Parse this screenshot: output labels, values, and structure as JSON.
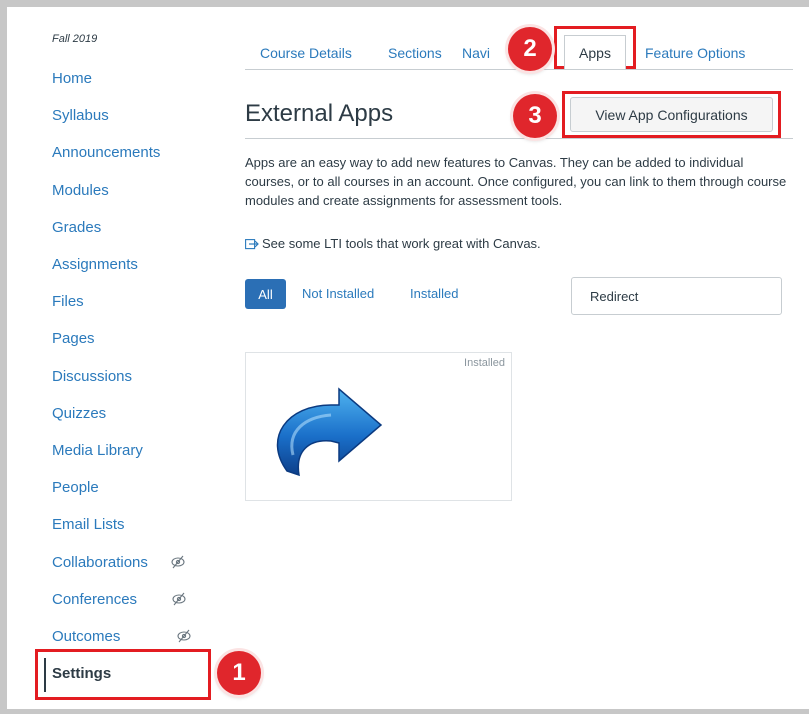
{
  "term": "Fall 2019",
  "nav": {
    "items": [
      {
        "label": "Home"
      },
      {
        "label": "Syllabus"
      },
      {
        "label": "Announcements"
      },
      {
        "label": "Modules"
      },
      {
        "label": "Grades"
      },
      {
        "label": "Assignments"
      },
      {
        "label": "Files"
      },
      {
        "label": "Pages"
      },
      {
        "label": "Discussions"
      },
      {
        "label": "Quizzes"
      },
      {
        "label": "Media Library"
      },
      {
        "label": "People"
      },
      {
        "label": "Email Lists"
      },
      {
        "label": "Collaborations",
        "hidden_icon": "eye-slash-icon"
      },
      {
        "label": "Conferences",
        "hidden_icon": "eye-slash-icon"
      },
      {
        "label": "Outcomes",
        "hidden_icon": "eye-slash-icon"
      }
    ],
    "active": "Settings"
  },
  "callouts": [
    "1",
    "2",
    "3"
  ],
  "tabs": {
    "course_details": "Course Details",
    "sections": "Sections",
    "navigation": "Navi",
    "apps": "Apps",
    "feature_options": "Feature Options"
  },
  "main": {
    "title": "External Apps",
    "view_config_button": "View App Configurations",
    "description": "Apps are an easy way to add new features to Canvas. They can be added to individual courses, or to all courses in an account. Once configured, you can link to them through course modules and create assignments for assessment tools.",
    "lti_link": "See some LTI tools that work great with Canvas.",
    "filters": {
      "all": "All",
      "not_installed": "Not Installed",
      "installed": "Installed"
    },
    "search_value": "Redirect",
    "app_card": {
      "status": "Installed",
      "icon": "redirect-arrow-icon"
    }
  },
  "colors": {
    "link": "#2b7abc",
    "callout_red": "#e31c21",
    "primary_button": "#2b6fb5"
  }
}
